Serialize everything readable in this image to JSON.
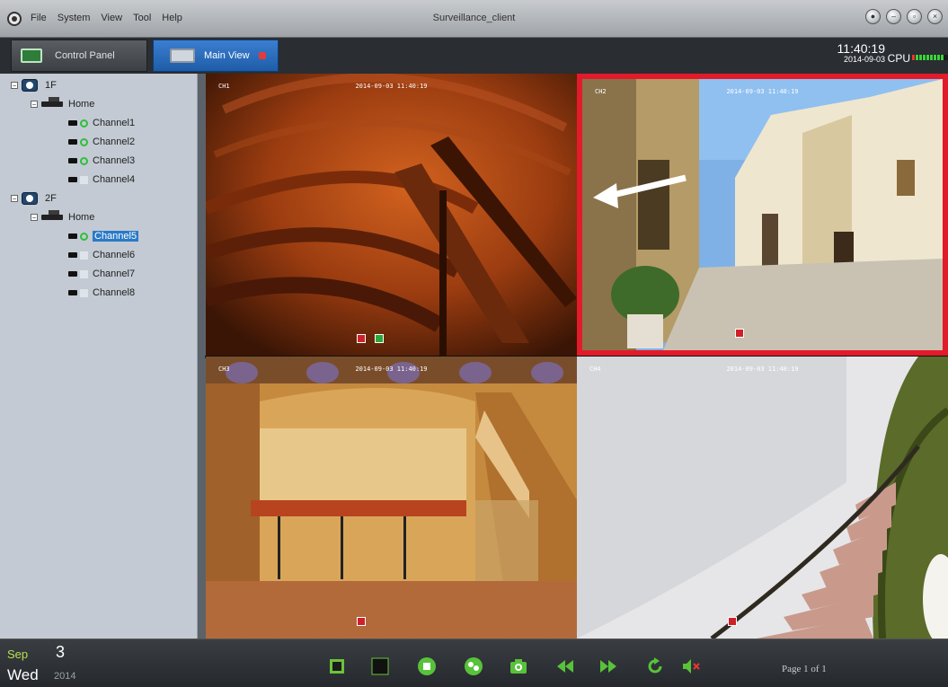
{
  "titlebar": {
    "menu": [
      "File",
      "System",
      "View",
      "Tool",
      "Help"
    ],
    "title": "Surveillance_client",
    "controls": [
      "settings",
      "minimize",
      "maximize",
      "close"
    ]
  },
  "tabs": [
    {
      "label": "Control Panel",
      "icon": "control-panel-icon",
      "active": false
    },
    {
      "label": "Main View",
      "icon": "monitor-icon",
      "active": true
    }
  ],
  "status": {
    "time": "11:40:19",
    "date": "2014-09-03",
    "cpu_label": "CPU"
  },
  "tree": {
    "devices": [
      {
        "name": "1F",
        "group": "Home",
        "channels": [
          {
            "label": "Channel1",
            "online": true
          },
          {
            "label": "Channel2",
            "online": true
          },
          {
            "label": "Channel3",
            "online": true
          },
          {
            "label": "Channel4",
            "online": false
          }
        ]
      },
      {
        "name": "2F",
        "group": "Home",
        "channels": [
          {
            "label": "Channel5",
            "online": true,
            "selected": true
          },
          {
            "label": "Channel6",
            "online": false
          },
          {
            "label": "Channel7",
            "online": false
          },
          {
            "label": "Channel8",
            "online": false
          }
        ]
      }
    ]
  },
  "grid": {
    "layout": "2x2",
    "selected_cell": 2,
    "accent_color": "#e21b2b"
  },
  "bottom": {
    "month": "Sep",
    "day": "3",
    "weekday": "Wed",
    "year": "2014",
    "toolbar": [
      "fullscreen-icon",
      "single-view-icon",
      "stop-icon",
      "multi-view-icon",
      "snapshot-icon",
      "rewind-icon",
      "fast-forward-icon",
      "refresh-icon",
      "mute-icon"
    ],
    "page": "Page 1 of 1"
  }
}
